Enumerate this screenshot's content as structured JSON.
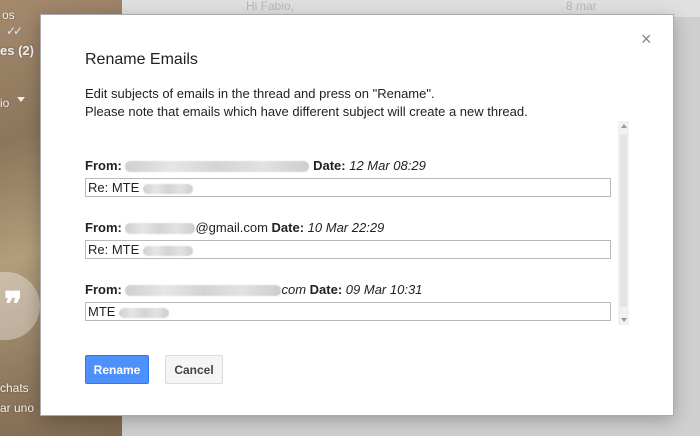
{
  "background": {
    "top_row_snippet": "Hi Fabio,",
    "top_row_date": "8 mar",
    "sidebar_fragment_1": "os",
    "sidebar_fragment_2": "es (2)",
    "sidebar_fragment_3": "io",
    "sidebar_fragment_4": "chats",
    "sidebar_fragment_5": "ar uno"
  },
  "dialog": {
    "title": "Rename Emails",
    "close_label": "×",
    "instruction_line1": "Edit subjects of emails in the thread and press on \"Rename\".",
    "instruction_line2": "Please note that emails which have different subject will create a new thread.",
    "from_label": "From:",
    "date_label": "Date:",
    "entries": [
      {
        "from_suffix": "",
        "date": "12 Mar 08:29",
        "subject": "Re: MTE"
      },
      {
        "from_suffix": "@gmail.com",
        "date": "10 Mar 22:29",
        "subject": "Re: MTE"
      },
      {
        "from_suffix": "com",
        "date": "09 Mar 10:31",
        "subject": "MTE"
      }
    ],
    "rename_button": "Rename",
    "cancel_button": "Cancel"
  },
  "colors": {
    "primary_button": "#4d90fe",
    "secondary_button": "#f5f5f5"
  }
}
